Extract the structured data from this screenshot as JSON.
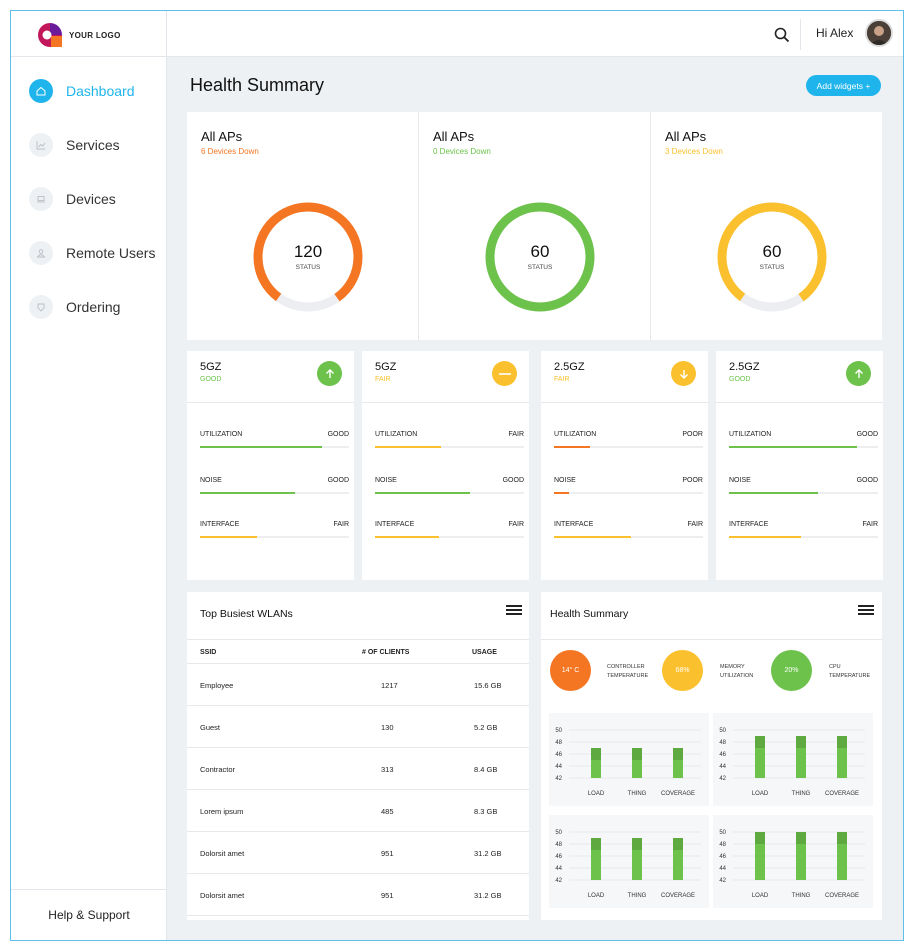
{
  "logo": {
    "text": "YOUR LOGO"
  },
  "nav": [
    {
      "label": "Dashboard",
      "icon": "home-icon",
      "active": true
    },
    {
      "label": "Services",
      "icon": "chart-icon",
      "active": false
    },
    {
      "label": "Devices",
      "icon": "laptop-icon",
      "active": false
    },
    {
      "label": "Remote Users",
      "icon": "user-icon",
      "active": false
    },
    {
      "label": "Ordering",
      "icon": "tag-icon",
      "active": false
    }
  ],
  "help": "Help & Support",
  "topbar": {
    "greeting": "Hi Alex"
  },
  "page": {
    "title": "Health Summary",
    "add_widgets": "Add widgets +"
  },
  "aps": [
    {
      "title": "All APs",
      "subtitle": "6 Devices Down",
      "value": "120",
      "label": "STATUS",
      "color": "#f47522",
      "fill": 0.8
    },
    {
      "title": "All APs",
      "subtitle": "0 Devices Down",
      "value": "60",
      "label": "STATUS",
      "color": "#6cc24a",
      "fill": 1.0
    },
    {
      "title": "All APs",
      "subtitle": "3 Devices Down",
      "value": "60",
      "label": "STATUS",
      "color": "#fbc02d",
      "fill": 0.8
    }
  ],
  "bands": [
    {
      "title": "5GZ",
      "status": "GOOD",
      "status_color": "#6cc24a",
      "icon": "arrow-up-icon",
      "metrics": [
        {
          "name": "UTILIZATION",
          "value": "GOOD",
          "fill": 0.82,
          "color": "#6cc24a"
        },
        {
          "name": "NOISE",
          "value": "GOOD",
          "fill": 0.64,
          "color": "#6cc24a"
        },
        {
          "name": "INTERFACE",
          "value": "FAIR",
          "fill": 0.38,
          "color": "#fbc02d"
        }
      ]
    },
    {
      "title": "5GZ",
      "status": "FAIR",
      "status_color": "#fbc02d",
      "icon": "minus-icon",
      "metrics": [
        {
          "name": "UTILIZATION",
          "value": "FAIR",
          "fill": 0.44,
          "color": "#fbc02d"
        },
        {
          "name": "NOISE",
          "value": "GOOD",
          "fill": 0.64,
          "color": "#6cc24a"
        },
        {
          "name": "INTERFACE",
          "value": "FAIR",
          "fill": 0.43,
          "color": "#fbc02d"
        }
      ]
    },
    {
      "title": "2.5GZ",
      "status": "FAIR",
      "status_color": "#fbc02d",
      "icon": "arrow-down-icon",
      "metrics": [
        {
          "name": "UTILIZATION",
          "value": "POOR",
          "fill": 0.24,
          "color": "#f47522"
        },
        {
          "name": "NOISE",
          "value": "POOR",
          "fill": 0.1,
          "color": "#f47522"
        },
        {
          "name": "INTERFACE",
          "value": "FAIR",
          "fill": 0.52,
          "color": "#fbc02d"
        }
      ]
    },
    {
      "title": "2.5GZ",
      "status": "GOOD",
      "status_color": "#6cc24a",
      "icon": "arrow-up-icon",
      "metrics": [
        {
          "name": "UTILIZATION",
          "value": "GOOD",
          "fill": 0.86,
          "color": "#6cc24a"
        },
        {
          "name": "NOISE",
          "value": "GOOD",
          "fill": 0.6,
          "color": "#6cc24a"
        },
        {
          "name": "INTERFACE",
          "value": "FAIR",
          "fill": 0.48,
          "color": "#fbc02d"
        }
      ]
    }
  ],
  "wlan": {
    "title": "Top Busiest WLANs",
    "headers": [
      "SSID",
      "# OF CLIENTS",
      "USAGE"
    ],
    "rows": [
      [
        "Employee",
        "1217",
        "15.6 GB"
      ],
      [
        "Guest",
        "130",
        "5.2 GB"
      ],
      [
        "Contractor",
        "313",
        "8.4 GB"
      ],
      [
        "Lorem ipsum",
        "485",
        "8.3 GB"
      ],
      [
        "Dolorsit amet",
        "951",
        "31.2 GB"
      ],
      [
        "Dolorsit amet",
        "951",
        "31.2 GB"
      ]
    ]
  },
  "health": {
    "title": "Health Summary",
    "gauges": [
      {
        "value": "14° C",
        "label": "CONTROLLER\nTEMPERATURE",
        "color": "#f47522"
      },
      {
        "value": "68%",
        "label": "MEMORY\nUTILIZATION",
        "color": "#fbc02d"
      },
      {
        "value": "20%",
        "label": "CPU\nTEMPERATURE",
        "color": "#6cc24a"
      }
    ]
  },
  "chart_data": [
    {
      "type": "bar",
      "categories": [
        "LOAD",
        "THING",
        "COVERAGE"
      ],
      "yticks": [
        50,
        48,
        46,
        44,
        42
      ],
      "ylim": [
        42,
        50
      ],
      "series": [
        {
          "values": [
            47,
            47,
            47
          ]
        }
      ],
      "color": "#6cc24a"
    },
    {
      "type": "bar",
      "categories": [
        "LOAD",
        "THING",
        "COVERAGE"
      ],
      "yticks": [
        50,
        48,
        46,
        44,
        42
      ],
      "ylim": [
        42,
        50
      ],
      "series": [
        {
          "values": [
            49,
            49,
            49
          ]
        }
      ],
      "color": "#6cc24a"
    },
    {
      "type": "bar",
      "categories": [
        "LOAD",
        "THING",
        "COVERAGE"
      ],
      "yticks": [
        50,
        48,
        46,
        44,
        42
      ],
      "ylim": [
        42,
        50
      ],
      "series": [
        {
          "values": [
            49,
            49,
            49
          ]
        }
      ],
      "color": "#6cc24a"
    },
    {
      "type": "bar",
      "categories": [
        "LOAD",
        "THING",
        "COVERAGE"
      ],
      "yticks": [
        50,
        48,
        46,
        44,
        42
      ],
      "ylim": [
        42,
        50
      ],
      "series": [
        {
          "values": [
            50,
            50,
            50
          ]
        }
      ],
      "color": "#6cc24a"
    }
  ]
}
